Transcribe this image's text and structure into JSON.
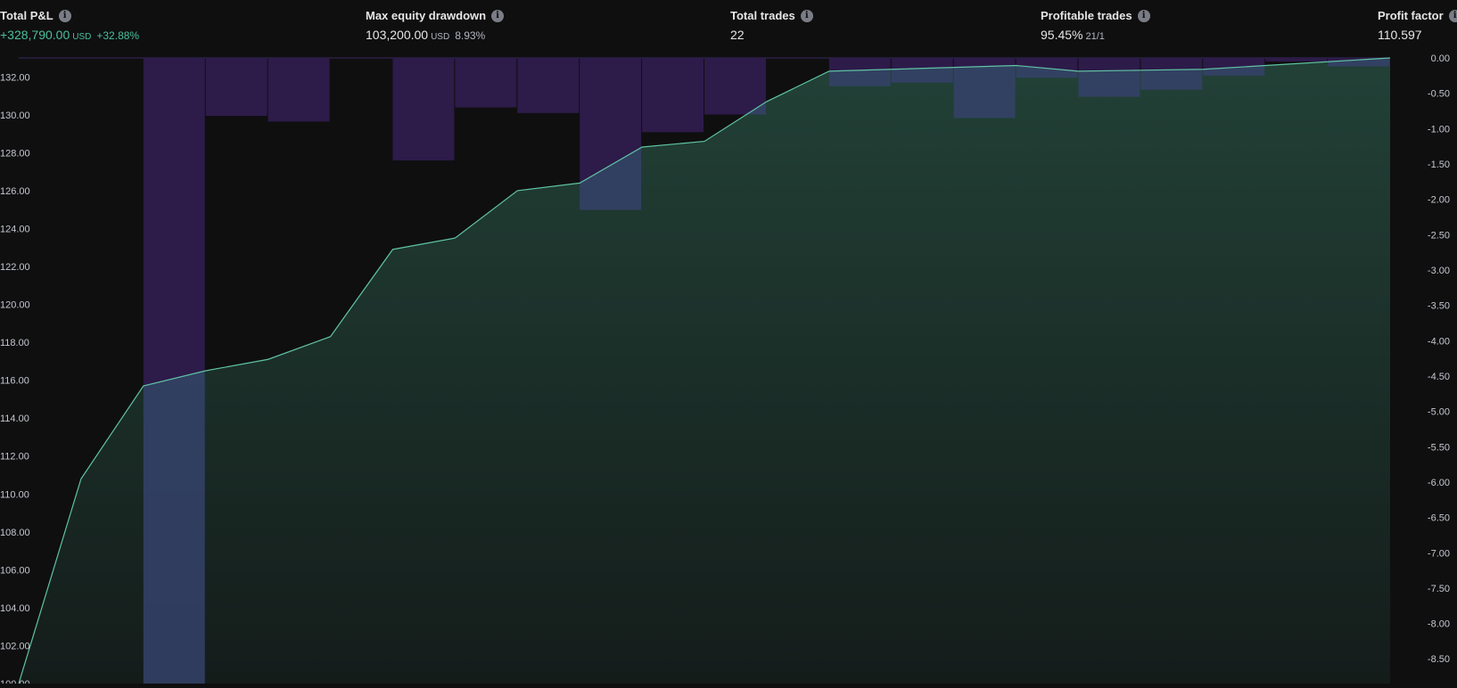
{
  "header": {
    "metrics": [
      {
        "id": "total-pnl",
        "title": "Total P&L",
        "value": "+328,790.00",
        "unit": "USD",
        "pct": "+32.88%",
        "positive": true
      },
      {
        "id": "max-drawdown",
        "title": "Max equity drawdown",
        "value": "103,200.00",
        "unit": "USD",
        "pct": "8.93%",
        "positive": false
      },
      {
        "id": "total-trades",
        "title": "Total trades",
        "value": "22",
        "unit": "",
        "pct": "",
        "positive": false
      },
      {
        "id": "profitable-trades",
        "title": "Profitable trades",
        "value": "95.45%",
        "unit": "",
        "pct": "21/1",
        "positive": false
      },
      {
        "id": "profit-factor",
        "title": "Profit factor",
        "value": "110.597",
        "unit": "",
        "pct": "",
        "positive": false
      }
    ]
  },
  "colors": {
    "background": "#0f0f10",
    "equity_line": "#5fc3a3",
    "equity_fill_top": "#224137",
    "equity_fill_bottom": "#141c1a",
    "drawdown_bar": "#2d1b4a",
    "overlap_bar": "#35426a",
    "axis_text": "#c5c8d0",
    "positive": "#4bbf9a"
  },
  "chart_data": {
    "type": "area",
    "left_axis": {
      "ticks": [
        "132.00",
        "130.00",
        "128.00",
        "126.00",
        "124.00",
        "122.00",
        "120.00",
        "118.00",
        "116.00",
        "114.00",
        "112.00",
        "110.00",
        "108.00",
        "106.00",
        "104.00",
        "102.00",
        "100.00"
      ],
      "range": [
        100,
        133
      ]
    },
    "right_axis": {
      "ticks": [
        "0.00",
        "-0.50",
        "-1.00",
        "-1.50",
        "-2.00",
        "-2.50",
        "-3.00",
        "-3.50",
        "-4.00",
        "-4.50",
        "-5.00",
        "-5.50",
        "-6.00",
        "-6.50",
        "-7.00",
        "-7.50",
        "-8.00",
        "-8.50"
      ],
      "range": [
        -8.85,
        0
      ]
    },
    "series": [
      {
        "kind": "equity",
        "x": [
          0,
          1,
          2,
          3,
          4,
          5,
          6,
          7,
          8,
          9,
          10,
          11,
          12,
          13,
          14,
          15,
          16,
          17,
          18,
          19,
          20,
          21,
          22
        ],
        "values": [
          100.0,
          110.8,
          115.7,
          116.5,
          117.1,
          118.3,
          122.9,
          123.5,
          126.0,
          126.4,
          128.3,
          128.6,
          130.7,
          132.3,
          132.4,
          132.5,
          132.6,
          132.3,
          132.35,
          132.4,
          132.6,
          132.8,
          133.0
        ]
      },
      {
        "kind": "drawdown",
        "values": [
          0,
          0,
          0,
          -8.85,
          -0.82,
          -0.9,
          0,
          -1.45,
          -0.7,
          -0.78,
          -2.15,
          -1.05,
          -0.8,
          0,
          -0.4,
          -0.35,
          -0.85,
          -0.28,
          -0.55,
          -0.45,
          -0.25,
          -0.05,
          -0.12
        ]
      }
    ]
  }
}
